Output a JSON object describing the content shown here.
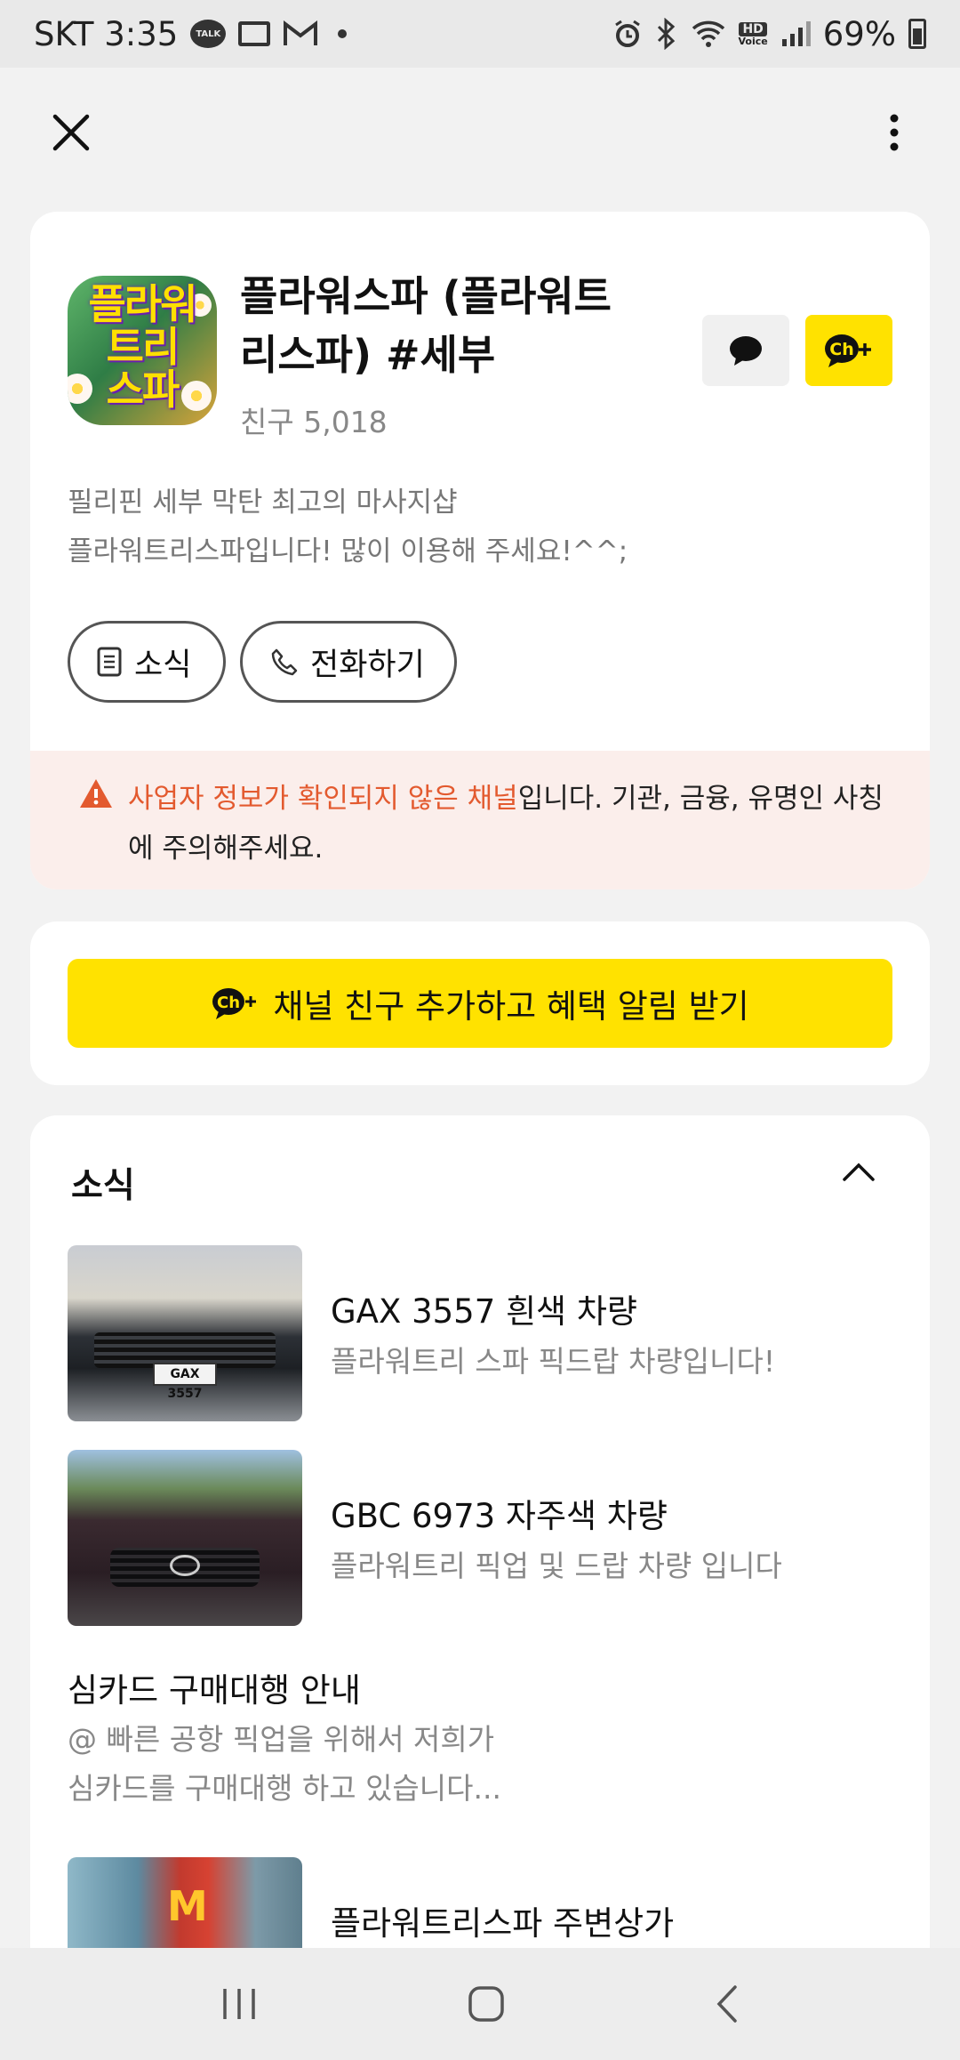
{
  "status_bar": {
    "carrier_time": "SKT 3:35",
    "talk_label": "TALK",
    "hd_label": "HD",
    "voice_label": "Voice",
    "battery": "69%"
  },
  "channel": {
    "logo_text": "플라워\n트리\n스파",
    "name": "플라워스파 (플라워트리스파) #세부",
    "friends": "친구 5,018",
    "description_line1": "필리핀 세부 막탄 최고의 마사지샵",
    "description_line2": "플라워트리스파입니다! 많이 이용해 주세요!^^;",
    "news_button": "소식",
    "call_button": "전화하기",
    "addch_icon_text": "Ch",
    "warning_highlight": "사업자 정보가 확인되지 않은 채널",
    "warning_rest": "입니다. 기관, 금융, 유명인 사칭에 주의해주세요."
  },
  "cta": {
    "label": "채널 친구 추가하고 혜택 알림 받기",
    "icon_text": "Ch"
  },
  "news": {
    "title": "소식",
    "items": [
      {
        "title": "GAX 3557 흰색 차량",
        "subtitle": "플라워트리 스파 픽드랍  차량입니다!",
        "plate": "GAX 3557"
      },
      {
        "title": "GBC 6973 자주색 차량",
        "subtitle": "플라워트리 픽업 및 드랍 차량 입니다"
      }
    ],
    "text_item": {
      "title": "심카드 구매대행 안내",
      "line1": "@ 빠른 공항 픽업을 위해서 저희가",
      "line2": "심카드를 구매대행 하고 있습니다..."
    },
    "partial_item": {
      "title": "플라워트리스파 주변상가"
    }
  },
  "colors": {
    "accent_yellow": "#ffe200",
    "warning_red": "#e35a2f",
    "warning_bg": "#fbeeeb"
  }
}
